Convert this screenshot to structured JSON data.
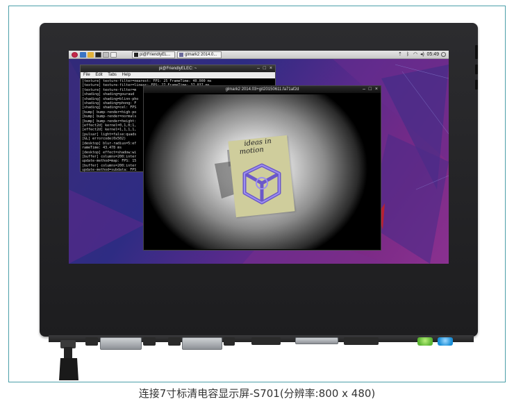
{
  "caption": "连接7寸标清电容显示屏-S701(分辨率:800 x 480)",
  "taskbar": {
    "buttons": [
      {
        "label": "pi@FriendlyEL..."
      },
      {
        "label": "glmark2 2014.0..."
      }
    ],
    "clock": "05:49",
    "tray_icons": [
      "wifi-icon",
      "bluetooth-icon",
      "volume-icon"
    ]
  },
  "terminal": {
    "title": "pi@FriendlyELEC: ~",
    "menu": [
      "File",
      "Edit",
      "Tabs",
      "Help"
    ],
    "lines": [
      "[texture] texture-filter=nearest: FPS: 25 FrameTime: 40.000 ms",
      "[texture] texture-filter=linear: FPS: 27 FrameTime: 37.037 ms",
      "[texture] texture-filter=m",
      "[shading] shading=gouraud",
      "[shading] shading=blinn-pho",
      "[shading] shading=phong: F",
      "[shading] shading=cel: FPS",
      "[bump] bump-render=high-po",
      "[bump] bump-render=normals",
      "[bump] bump-render=height:",
      "[effect2d] kernel=0,1,0;1,",
      "[effect2d] kernel=1,1,1,1,",
      "[pulsar] light=false:quads",
      "[GL] errorcode(0x502)",
      "[desktop] blur-radius=5:ef",
      "rameTime: 43.478 ms",
      "[desktop] effect=shadow:wi",
      "[buffer] columns=200:inter",
      "update-method=map: FPS: 15",
      "[buffer] columns=200:inter",
      "update-method=subdata: FPS",
      "[buffer] columns=200:inter",
      "pdate-method=map: FPS: 16 F",
      "[ideas] speed=duration:"
    ]
  },
  "glmark": {
    "title": "glmark2 2014.03+git20150611.fa71af2d",
    "card_text_line1": "ideas in",
    "card_text_line2": "motion"
  },
  "colors": {
    "desktop_purple": "#5c2a8c",
    "taskbar": "#d6d6d6",
    "terminal_bg": "#000000",
    "frame_border": "#4a9ea8",
    "cube": "#7b68d8"
  }
}
